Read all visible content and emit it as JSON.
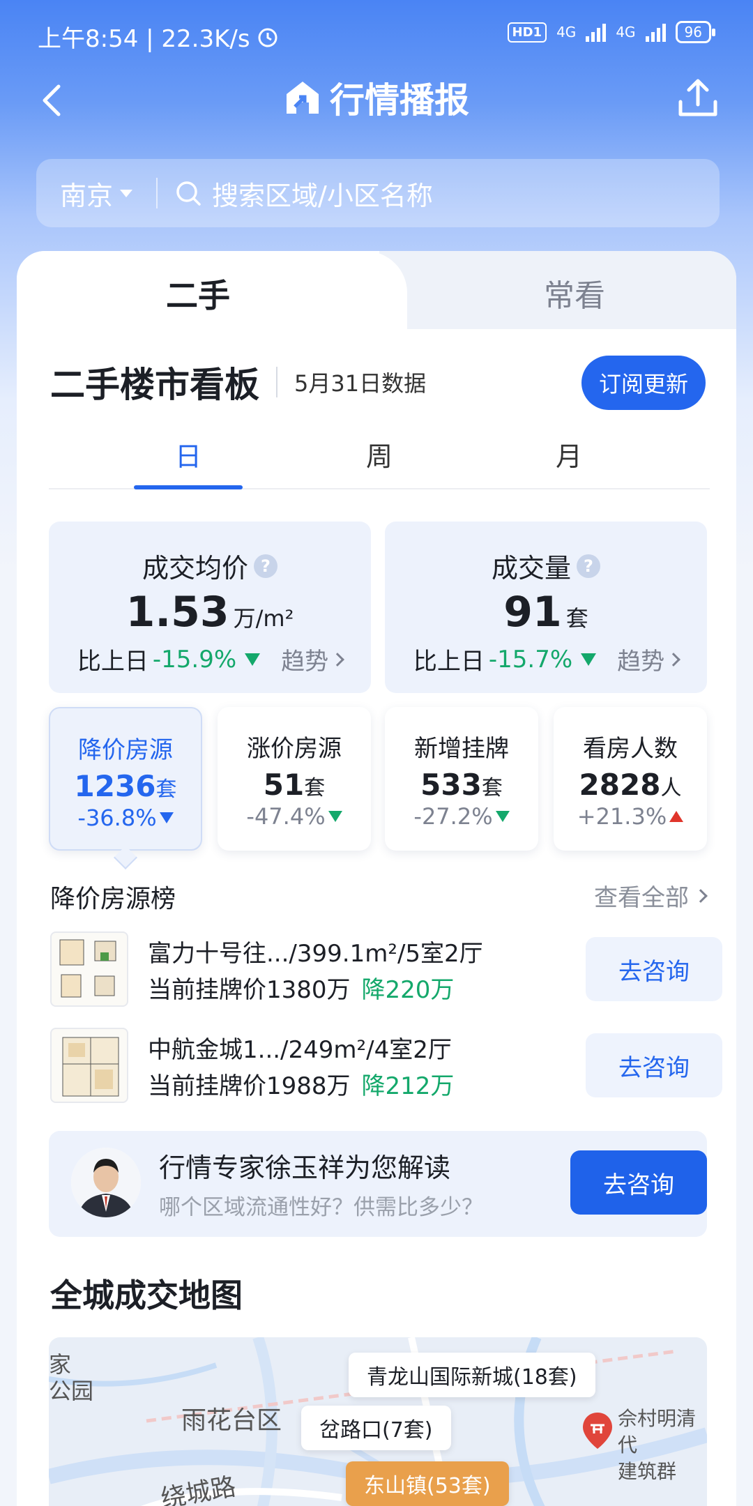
{
  "status_bar": {
    "time": "上午8:54 | 22.3K/s",
    "hd": "HD1",
    "net1": "4G",
    "net2": "4G",
    "battery": "96"
  },
  "nav": {
    "title": "行情播报"
  },
  "search": {
    "city": "南京",
    "placeholder": "搜索区域/小区名称"
  },
  "tabs": {
    "primary": "二手",
    "secondary": "常看"
  },
  "board": {
    "title": "二手楼市看板",
    "date": "5月31日数据",
    "subscribe": "订阅更新"
  },
  "period_tabs": [
    {
      "label": "日"
    },
    {
      "label": "周"
    },
    {
      "label": "月"
    }
  ],
  "stats_main": [
    {
      "label": "成交均价",
      "value": "1.53",
      "unit": "万/m²",
      "compare_prefix": "比上日",
      "change": "-15.9%",
      "trend": "趋势"
    },
    {
      "label": "成交量",
      "value": "91",
      "unit": "套",
      "compare_prefix": "比上日",
      "change": "-15.7%",
      "trend": "趋势"
    }
  ],
  "stats_small": [
    {
      "label": "降价房源",
      "value": "1236",
      "unit": "套",
      "change": "-36.8%"
    },
    {
      "label": "涨价房源",
      "value": "51",
      "unit": "套",
      "change": "-47.4%"
    },
    {
      "label": "新增挂牌",
      "value": "533",
      "unit": "套",
      "change": "-27.2%"
    },
    {
      "label": "看房人数",
      "value": "2828",
      "unit": "人",
      "change": "+21.3%"
    }
  ],
  "list": {
    "title": "降价房源榜",
    "see_all": "查看全部",
    "items": [
      {
        "title": "富力十号往.../399.1m²/5室2厅",
        "price_prefix": "当前挂牌价1380万",
        "drop": "降220万",
        "action": "去咨询"
      },
      {
        "title": "中航金城1.../249m²/4室2厅",
        "price_prefix": "当前挂牌价1988万",
        "drop": "降212万",
        "action": "去咨询"
      }
    ]
  },
  "expert": {
    "title": "行情专家徐玉祥为您解读",
    "subtitle": "哪个区域流通性好？供需比多少？",
    "action": "去咨询"
  },
  "map": {
    "title": "全城成交地图",
    "labels": [
      "雨花台区",
      "绕城路",
      "家",
      "公园"
    ],
    "pills": [
      "青龙山国际新城(18套)",
      "岔路口(7套)",
      "东山镇(53套)"
    ],
    "poi": [
      "佘村明清代",
      "建筑群"
    ]
  },
  "colors": {
    "accent": "#2466ee",
    "down": "#14a86b",
    "up": "#e0352b"
  }
}
